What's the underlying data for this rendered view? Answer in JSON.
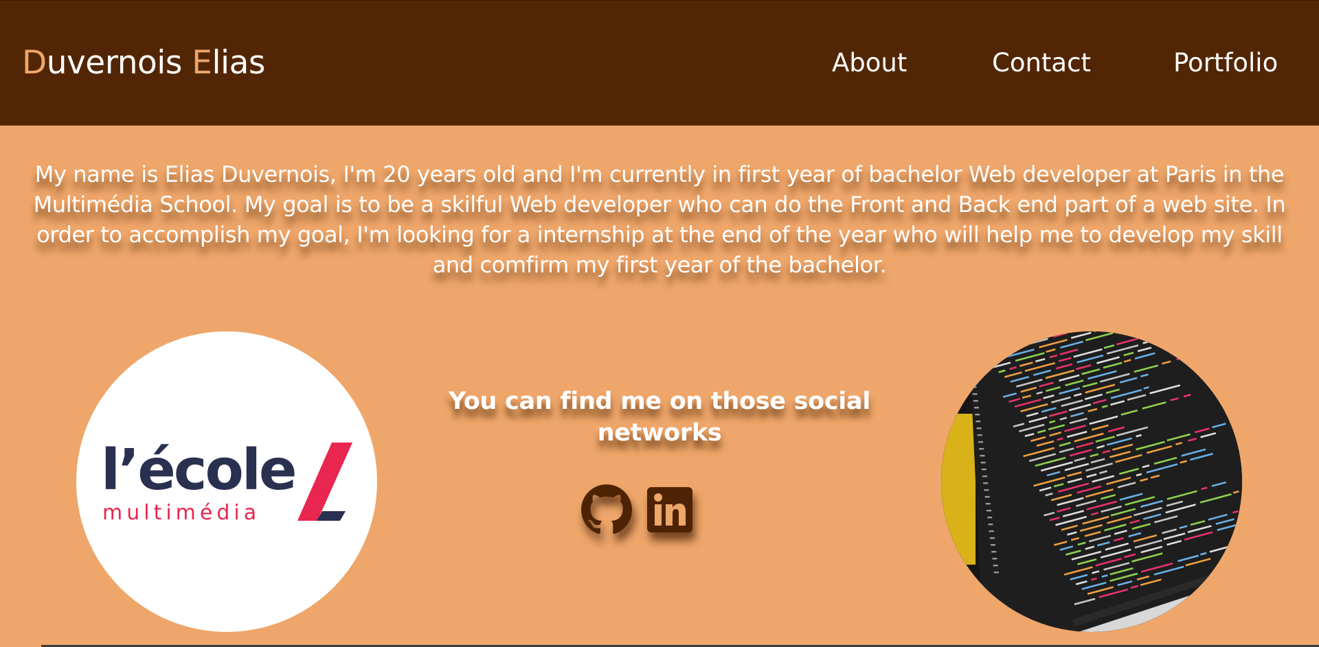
{
  "header": {
    "brand_first_initial": "D",
    "brand_first_rest": "uvernois ",
    "brand_second_initial": "E",
    "brand_second_rest": "lias",
    "nav": {
      "about": "About",
      "contact": "Contact",
      "portfolio": "Portfolio"
    }
  },
  "intro": {
    "text": "My name is Elias Duvernois, I'm 20 years old and I'm currently in first year of bachelor Web developer at Paris in the Multimédia School. My goal is to be a skilful Web developer who can do the Front and Back end part of a web site. In order to accomplish my goal, I'm looking for a internship at the end of the year who will help me to develop my skill and comfirm my first year of the bachelor."
  },
  "school_logo": {
    "main_text": "l’école",
    "sub_text": "multimédia"
  },
  "social": {
    "title": "You can find me on those social networks",
    "icons": [
      "github-icon",
      "linkedin-icon"
    ]
  },
  "colors": {
    "header_bg": "#522604",
    "page_bg": "#eea66a",
    "accent": "#eea66a",
    "logo_navy": "#2a3050",
    "logo_red": "#e8264f"
  }
}
